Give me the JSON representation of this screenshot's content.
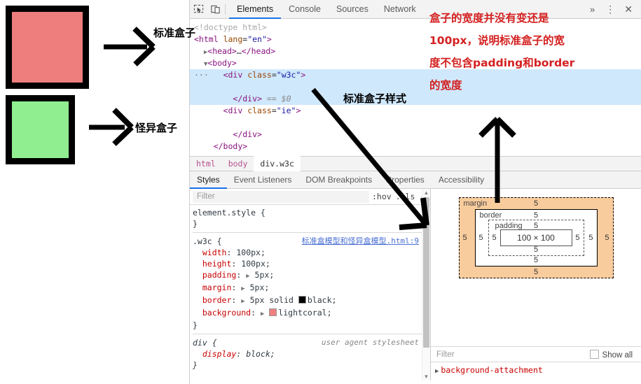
{
  "demo": {
    "standard_box_label": "标准盒子",
    "quirk_box_label": "怪异盒子",
    "standard_box_color": "#ee7e7e",
    "quirk_box_color": "#90ee90",
    "border_color": "#000000"
  },
  "annotations": {
    "style_label": "标准盒子样式",
    "red_note_lines": [
      "盒子的宽度并没有变还是",
      "100px，说明标准盒子的宽",
      "度不包含padding和border",
      "的宽度"
    ],
    "red_color": "#d42020"
  },
  "devtools": {
    "tabs": [
      {
        "label": "Elements",
        "active": true
      },
      {
        "label": "Console",
        "active": false
      },
      {
        "label": "Sources",
        "active": false
      },
      {
        "label": "Network",
        "active": false
      }
    ],
    "more_tabs_icon": "»",
    "menu_icon": "⋮",
    "close_icon": "✕",
    "inspect_icon": "inspect-element-icon",
    "device_icon": "device-toolbar-icon",
    "dom": {
      "lines": [
        {
          "indent": 0,
          "marker": "",
          "text": "<!doctype html>",
          "kind": "doctype",
          "selected": false
        },
        {
          "indent": 0,
          "marker": "",
          "text": "<html lang=\"en\">",
          "kind": "tag",
          "selected": false
        },
        {
          "indent": 1,
          "marker": "▶",
          "text": "<head>…</head>",
          "kind": "tag",
          "selected": false
        },
        {
          "indent": 1,
          "marker": "▼",
          "text": "<body>",
          "kind": "tag",
          "selected": false
        },
        {
          "indent": 2,
          "marker": "···",
          "text": "<div class=\"w3c\">",
          "kind": "tag",
          "selected": true
        },
        {
          "indent": 3,
          "marker": "",
          "text": "",
          "kind": "blank",
          "selected": true
        },
        {
          "indent": 3,
          "marker": "",
          "text": "</div> == $0",
          "kind": "tag-eq",
          "selected": true
        },
        {
          "indent": 2,
          "marker": "",
          "text": "<div class=\"ie\">",
          "kind": "tag",
          "selected": false
        },
        {
          "indent": 3,
          "marker": "",
          "text": "",
          "kind": "blank",
          "selected": false
        },
        {
          "indent": 3,
          "marker": "",
          "text": "</div>",
          "kind": "tag",
          "selected": false
        },
        {
          "indent": 1,
          "marker": "",
          "text": "</body>",
          "kind": "tag",
          "selected": false
        }
      ]
    },
    "breadcrumb": [
      "html",
      "body",
      "div.w3c"
    ],
    "style_tabs": [
      {
        "label": "Styles",
        "active": true
      },
      {
        "label": "Event Listeners",
        "active": false
      },
      {
        "label": "DOM Breakpoints",
        "active": false
      },
      {
        "label": "Properties",
        "active": false
      },
      {
        "label": "Accessibility",
        "active": false
      }
    ],
    "styles": {
      "filter_placeholder": "Filter",
      "hov_label": ":hov",
      "cls_label": ".cls",
      "plus_label": "+",
      "rules": [
        {
          "selector": "element.style {",
          "source": "",
          "declarations": [],
          "close": "}"
        },
        {
          "selector": ".w3c {",
          "source": "标准盒模型和怪异盒模型.html:9",
          "declarations": [
            {
              "prop": "width",
              "value": "100px;",
              "expand": false,
              "swatch": ""
            },
            {
              "prop": "height",
              "value": "100px;",
              "expand": false,
              "swatch": ""
            },
            {
              "prop": "padding",
              "value": "5px;",
              "expand": true,
              "swatch": ""
            },
            {
              "prop": "margin",
              "value": "5px;",
              "expand": true,
              "swatch": ""
            },
            {
              "prop": "border",
              "value": "5px solid black;",
              "expand": true,
              "swatch": "#000000"
            },
            {
              "prop": "background",
              "value": "lightcoral;",
              "expand": true,
              "swatch": "#f08080"
            }
          ],
          "close": "}"
        },
        {
          "selector": "div {",
          "source": "user agent stylesheet",
          "declarations": [
            {
              "prop": "display",
              "value": "block;",
              "expand": false,
              "swatch": ""
            }
          ],
          "close": "}"
        }
      ]
    },
    "boxmodel": {
      "margin_label": "margin",
      "border_label": "border",
      "padding_label": "padding",
      "content_size": "100 × 100",
      "margin_values": {
        "top": "5",
        "right": "5",
        "bottom": "5",
        "left": "5"
      },
      "border_values": {
        "top": "5",
        "right": "5",
        "bottom": "5",
        "left": "5"
      },
      "padding_values": {
        "top": "5",
        "right": "5",
        "bottom": "5",
        "left": "5"
      },
      "margin_fill": "#f9cc9d"
    },
    "computed": {
      "filter_placeholder": "Filter",
      "show_all_label": "Show all",
      "first_property": "background-attachment"
    }
  }
}
